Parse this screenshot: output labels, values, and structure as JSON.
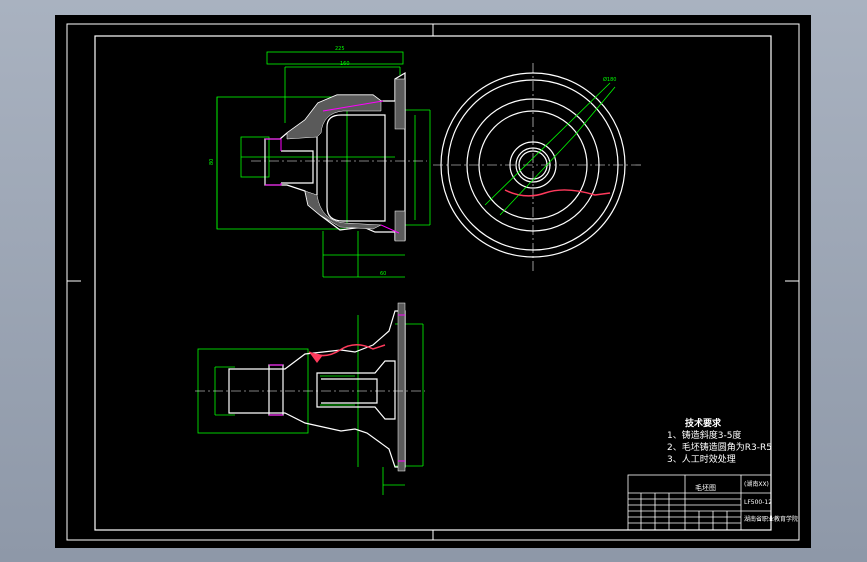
{
  "drawing": {
    "title_block": {
      "part_name": "毛坯图",
      "school": "(湖南XX)",
      "drawing_no": "LF500-12",
      "org": "湖南省职业教育学院"
    },
    "tech_notes": {
      "heading": "技术要求",
      "items": [
        "1、铸造斜度3-5度",
        "2、毛坯铸造圆角为R3-R5",
        "3、人工时效处理"
      ]
    },
    "colors": {
      "viewport": "#000000",
      "geometry": "#ffffff",
      "dimension": "#00ff00",
      "hatch": "#ff3a5c",
      "hidden": "#ff00ff",
      "center": "#ffffff"
    }
  }
}
